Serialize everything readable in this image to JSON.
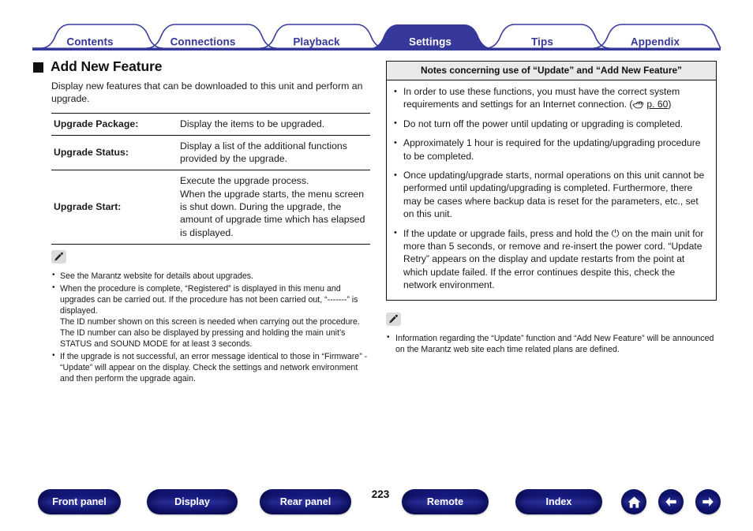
{
  "tabs": [
    {
      "label": "Contents",
      "active": false
    },
    {
      "label": "Connections",
      "active": false
    },
    {
      "label": "Playback",
      "active": false
    },
    {
      "label": "Settings",
      "active": true
    },
    {
      "label": "Tips",
      "active": false
    },
    {
      "label": "Appendix",
      "active": false
    }
  ],
  "colors": {
    "tab_accent": "#36399a",
    "tab_active_fill": "#36399a",
    "tab_active_text": "#ffffff",
    "rule": "#111111",
    "box_header_bg": "#e9e9e9",
    "button_blue": "#4348aa"
  },
  "heading": {
    "title": "Add New Feature"
  },
  "intro": "Display new features that can be downloaded to this unit and perform an upgrade.",
  "spec_table": {
    "rows": [
      {
        "key": "Upgrade Package:",
        "value": "Display the items to be upgraded."
      },
      {
        "key": "Upgrade Status:",
        "value": "Display a list of the additional functions provided by the upgrade."
      },
      {
        "key": "Upgrade Start:",
        "value": "Execute the upgrade process.\nWhen the upgrade starts, the menu screen is shut down. During the upgrade, the amount of upgrade time which has elapsed is displayed."
      }
    ]
  },
  "left_notes": {
    "icon": "pencil-icon",
    "items": [
      "See the Marantz website for details about upgrades.",
      "When the procedure is complete, “Registered” is displayed in this menu and upgrades can be carried out. If the procedure has not been carried out, “-------” is displayed.\nThe ID number shown on this screen is needed when carrying out the procedure.\nThe ID number can also be displayed by pressing and holding the main unit’s STATUS and SOUND MODE for at least 3 seconds.",
      "If the upgrade is not successful, an error message identical to those in “Firmware” - “Update” will appear on the display. Check the settings and network environment and then perform the upgrade again."
    ]
  },
  "notes_box": {
    "header": "Notes concerning use of “Update” and “Add New Feature”",
    "items": [
      {
        "text": "In order to use these functions, you must have the correct system requirements and settings for an Internet connection. ",
        "page_ref": "p. 60",
        "ref_icon": "pointing-hand-icon"
      },
      {
        "text": "Do not turn off the power until updating or upgrading is completed."
      },
      {
        "text": "Approximately 1 hour is required for the updating/upgrading procedure to be completed."
      },
      {
        "text": "Once updating/upgrade starts, normal operations on this unit cannot be performed until updating/upgrading is completed. Furthermore, there may be cases where backup data is reset for the parameters, etc., set on this unit."
      },
      {
        "text_before_power": "If the update or upgrade fails, press and hold the ",
        "power_symbol": "⏻",
        "text_after_power": " on the main unit for more than 5 seconds, or remove and re-insert the power cord. “Update Retry” appears on the display and update restarts from the point at which update failed. If the error continues despite this, check the network environment."
      }
    ]
  },
  "right_notes": {
    "icon": "pencil-icon",
    "items": [
      "Information regarding the “Update” function and “Add New Feature” will be announced on the Marantz web site each time related plans are defined."
    ]
  },
  "footer": {
    "page_number": "223",
    "buttons": [
      {
        "label": "Front panel",
        "name": "front-panel-button"
      },
      {
        "label": "Display",
        "name": "display-button"
      },
      {
        "label": "Rear panel",
        "name": "rear-panel-button"
      },
      {
        "label": "Remote",
        "name": "remote-button"
      },
      {
        "label": "Index",
        "name": "index-button"
      }
    ],
    "icon_buttons": [
      {
        "icon": "home-icon"
      },
      {
        "icon": "arrow-left-icon"
      },
      {
        "icon": "arrow-right-icon"
      }
    ]
  }
}
